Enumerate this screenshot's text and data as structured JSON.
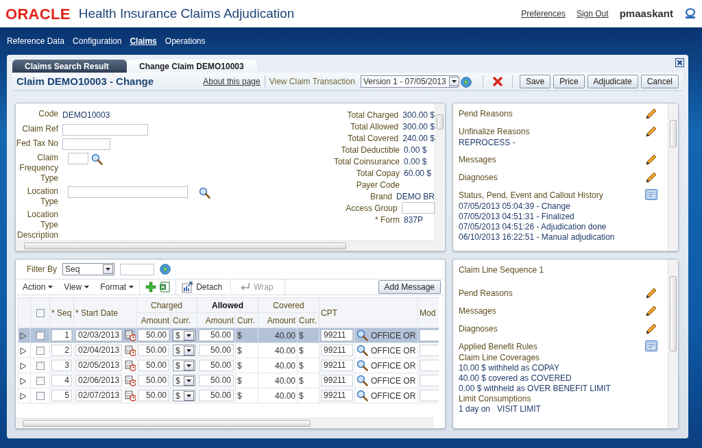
{
  "header": {
    "logo": "ORACLE",
    "app_title": "Health Insurance Claims Adjudication",
    "links": [
      "Preferences",
      "Sign Out"
    ],
    "user": "pmaaskant"
  },
  "nav": [
    {
      "label": "Reference Data",
      "selected": false
    },
    {
      "label": "Configuration",
      "selected": false
    },
    {
      "label": "Claims",
      "selected": true
    },
    {
      "label": "Operations",
      "selected": false
    }
  ],
  "tabs": [
    {
      "label": "Claims Search Result",
      "selected": false
    },
    {
      "label": "Change Claim DEMO10003",
      "selected": true
    }
  ],
  "page": {
    "title": "Claim DEMO10003 - Change",
    "about_link": "About this page",
    "view_link": "View Claim Transaction",
    "version": "Version 1 - 07/05/2013",
    "buttons": [
      "Save",
      "Price",
      "Adjudicate",
      "Cancel"
    ]
  },
  "claim_form": {
    "fields": [
      {
        "label": "Code",
        "kind": "text",
        "value": "DEMO10003"
      },
      {
        "label": "Claim Ref",
        "kind": "input"
      },
      {
        "label": "Fed Tax No",
        "kind": "input"
      },
      {
        "label": "Claim Frequency Type",
        "kind": "lookup"
      },
      {
        "label": "Location Type",
        "kind": "lookup"
      },
      {
        "label": "Location Type Description",
        "kind": "text"
      }
    ],
    "totals": [
      {
        "label": "Total Charged",
        "kind": "text",
        "value": "300.00 $"
      },
      {
        "label": "Total Allowed",
        "kind": "text",
        "value": "300.00 $"
      },
      {
        "label": "Total Covered",
        "kind": "text",
        "value": "240.00 $"
      },
      {
        "label": "Total Deductible",
        "kind": "text",
        "value": "0.00 $"
      },
      {
        "label": "Total Coinsurance",
        "kind": "text",
        "value": "0.00 $"
      },
      {
        "label": "Total Copay",
        "kind": "text",
        "value": "60.00 $"
      },
      {
        "label": "Payer Code",
        "kind": "text"
      },
      {
        "label": "Brand",
        "kind": "text",
        "value": "DEMO BR"
      },
      {
        "label": "Access Group",
        "kind": "input"
      },
      {
        "label": "* Form",
        "kind": "text",
        "value": "837P"
      }
    ]
  },
  "claim_sections": [
    {
      "title": "Pend Reasons",
      "kind": "edit"
    },
    {
      "title": "Unfinalize Reasons",
      "kind": "edit",
      "lines": [
        {
          "kind": "value",
          "text": "REPROCESS -"
        }
      ]
    },
    {
      "title": "Messages",
      "kind": "edit"
    },
    {
      "title": "Diagnoses",
      "kind": "edit"
    },
    {
      "title": "Status, Pend, Event and Callout History",
      "kind": "list",
      "lines": [
        {
          "kind": "value",
          "text": "07/05/2013 05:04:39 - Change"
        },
        {
          "kind": "value",
          "text": "07/05/2013 04:51:31 - Finalized"
        },
        {
          "kind": "value",
          "text": "07/05/2013 04:51:26 - Adjudication done"
        },
        {
          "kind": "value",
          "text": "06/10/2013 16:22:51 - Manual adjudication"
        }
      ]
    }
  ],
  "line_table": {
    "filter": {
      "label": "Filter By",
      "value": "Seq"
    },
    "menus": [
      "Action",
      "View",
      "Format"
    ],
    "tools": [
      {
        "label": "Detach",
        "disabled": false
      },
      {
        "label": "Wrap",
        "disabled": true
      }
    ],
    "add_button": "Add Message",
    "select_all_checked": false,
    "columns": [
      {
        "label": "* Seq"
      },
      {
        "label": "* Start Date"
      },
      {
        "label": "Charged",
        "highlighted": false,
        "sub": [
          "Amount",
          "Curr."
        ]
      },
      {
        "label": "Allowed",
        "highlighted": true,
        "sub": [
          "Amount",
          "Curr."
        ]
      },
      {
        "label": "Covered",
        "highlighted": false,
        "sub": [
          "Amount",
          "Curr."
        ]
      },
      {
        "label": "CPT"
      },
      {
        "label": "Mod"
      }
    ],
    "rows": [
      {
        "selected": true,
        "checked": false,
        "seq": "1",
        "start_date": "02/03/2013",
        "charged_amount": "50.00",
        "charged_curr": "$",
        "allowed_amount": "50.00",
        "allowed_curr": "$",
        "covered_amount": "40.00",
        "covered_curr": "$",
        "cpt": "99211",
        "cpt_description": "OFFICE OR"
      },
      {
        "selected": false,
        "checked": false,
        "seq": "2",
        "start_date": "02/04/2013",
        "charged_amount": "50.00",
        "charged_curr": "$",
        "allowed_amount": "50.00",
        "allowed_curr": "$",
        "covered_amount": "40.00",
        "covered_curr": "$",
        "cpt": "99211",
        "cpt_description": "OFFICE OR"
      },
      {
        "selected": false,
        "checked": false,
        "seq": "3",
        "start_date": "02/05/2013",
        "charged_amount": "50.00",
        "charged_curr": "$",
        "allowed_amount": "50.00",
        "allowed_curr": "$",
        "covered_amount": "40.00",
        "covered_curr": "$",
        "cpt": "99211",
        "cpt_description": "OFFICE OR"
      },
      {
        "selected": false,
        "checked": false,
        "seq": "4",
        "start_date": "02/06/2013",
        "charged_amount": "50.00",
        "charged_curr": "$",
        "allowed_amount": "50.00",
        "allowed_curr": "$",
        "covered_amount": "40.00",
        "covered_curr": "$",
        "cpt": "99211",
        "cpt_description": "OFFICE OR"
      },
      {
        "selected": false,
        "checked": false,
        "seq": "5",
        "start_date": "02/07/2013",
        "charged_amount": "50.00",
        "charged_curr": "$",
        "allowed_amount": "50.00",
        "allowed_curr": "$",
        "covered_amount": "40.00",
        "covered_curr": "$",
        "cpt": "99211",
        "cpt_description": "OFFICE OR"
      }
    ]
  },
  "line_panel": {
    "title": "Claim Line Sequence 1",
    "sections": [
      {
        "title": "Pend Reasons",
        "kind": "edit"
      },
      {
        "title": "Messages",
        "kind": "edit"
      },
      {
        "title": "Diagnoses",
        "kind": "edit"
      },
      {
        "title": "Applied Benefit Rules",
        "kind": "list",
        "lines": [
          {
            "kind": "heading",
            "text": "Claim Line Coverages"
          },
          {
            "kind": "value",
            "text": "10.00 $ withheld as COPAY"
          },
          {
            "kind": "value",
            "text": "40.00 $ covered as COVERED"
          },
          {
            "kind": "value",
            "text": "0.00 $ withheld as OVER BENEFIT LIMIT"
          },
          {
            "kind": "heading",
            "text": "Limit Consumptions"
          },
          {
            "kind": "value",
            "text": "1 day on   VISIT LIMIT"
          }
        ]
      }
    ]
  }
}
